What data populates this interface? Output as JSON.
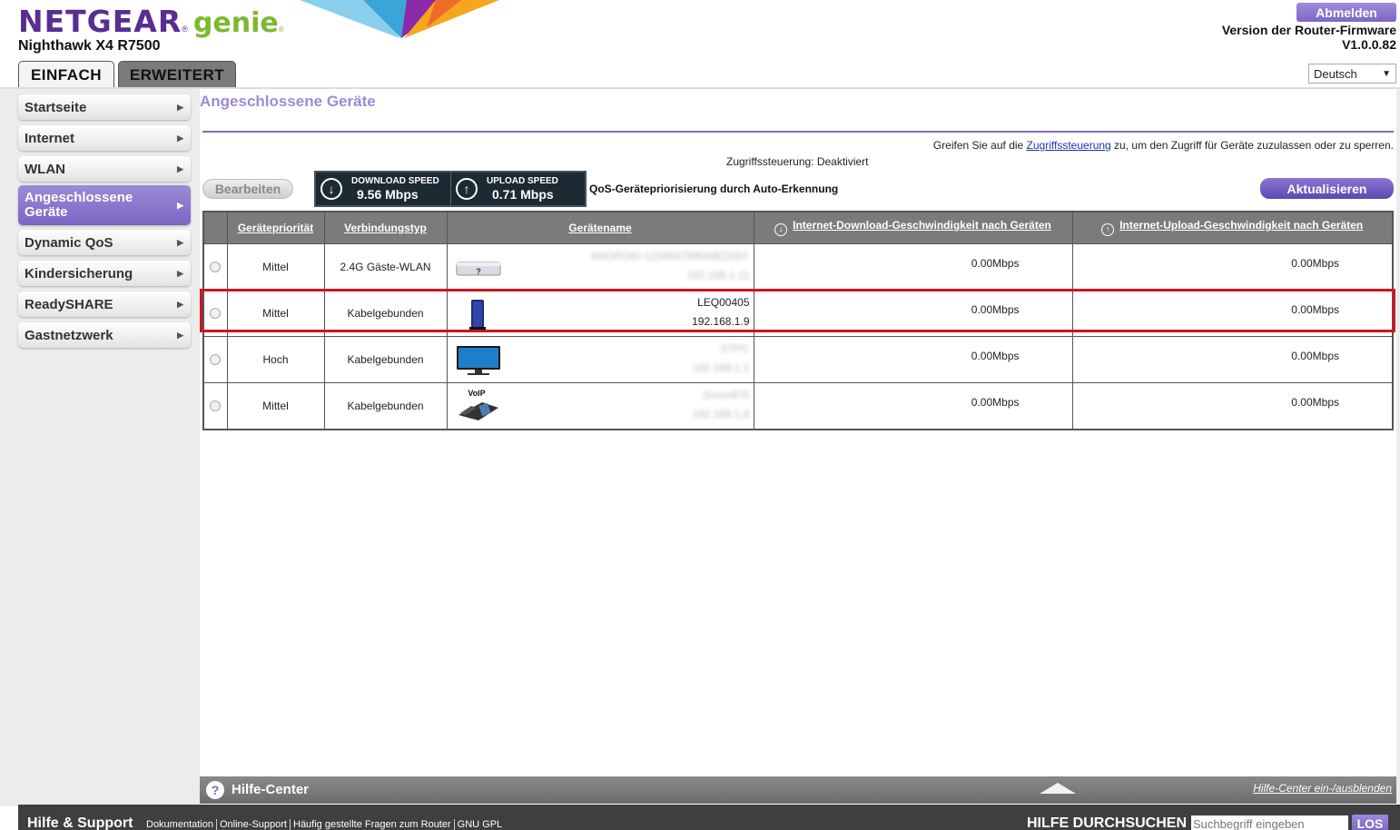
{
  "header": {
    "brand": "NETGEAR",
    "reg_mark": "®",
    "genie": "genie",
    "model": "Nighthawk X4 R7500",
    "logout_label": "Abmelden",
    "firmware_label": "Version der Router-Firmware",
    "firmware_version": "V1.0.0.82",
    "language": "Deutsch",
    "tabs": [
      {
        "label": "EINFACH",
        "active": true
      },
      {
        "label": "ERWEITERT",
        "active": false
      }
    ]
  },
  "sidebar": {
    "items": [
      {
        "label": "Startseite"
      },
      {
        "label": "Internet"
      },
      {
        "label": "WLAN"
      },
      {
        "label": "Angeschlossene Geräte",
        "active": true
      },
      {
        "label": "Dynamic QoS"
      },
      {
        "label": "Kindersicherung"
      },
      {
        "label": "ReadySHARE"
      },
      {
        "label": "Gastnetzwerk"
      }
    ]
  },
  "main": {
    "title": "Angeschlossene Geräte",
    "access_prefix": "Greifen Sie auf die ",
    "access_link": "Zugriffssteuerung",
    "access_suffix": " zu, um den Zugriff für Geräte zuzulassen oder zu sperren.",
    "access_status": "Zugriffssteuerung: Deaktiviert",
    "edit_label": "Bearbeiten",
    "download_label": "DOWNLOAD SPEED",
    "download_value": "9.56 Mbps",
    "upload_label": "UPLOAD SPEED",
    "upload_value": "0.71 Mbps",
    "qos_text": "QoS-Gerätepriorisierung durch Auto-Erkennung",
    "refresh_label": "Aktualisieren",
    "table": {
      "headers": [
        "Gerätepriorität",
        "Verbindungstyp",
        "Gerätename",
        "Internet-Download-Geschwindigkeit nach Geräten",
        "Internet-Upload-Geschwindigkeit nach Geräten"
      ],
      "rows": [
        {
          "priority": "Mittel",
          "type": "2.4G Gäste-WLAN",
          "icon": "unknown-device-icon",
          "name": "ANDROID-1234567890ABCDEF",
          "ip": "192.168.1.11",
          "blurred": true,
          "down": "0.00Mbps",
          "up": "0.00Mbps"
        },
        {
          "priority": "Mittel",
          "type": "Kabelgebunden",
          "icon": "router-device-icon",
          "name": "LEQ00405",
          "ip": "192.168.1.9",
          "blurred": false,
          "down": "0.00Mbps",
          "up": "0.00Mbps"
        },
        {
          "priority": "Hoch",
          "type": "Kabelgebunden",
          "icon": "monitor-device-icon",
          "name": "STPC",
          "ip": "192.168.1.2",
          "blurred": true,
          "down": "0.00Mbps",
          "up": "0.00Mbps"
        },
        {
          "priority": "Mittel",
          "type": "Kabelgebunden",
          "icon": "voip-phone-icon",
          "name": "Snom870",
          "ip": "192.168.1.8",
          "blurred": true,
          "down": "0.00Mbps",
          "up": "0.00Mbps"
        }
      ]
    }
  },
  "help_center": {
    "title": "Hilfe-Center",
    "toggle": "Hilfe-Center ein-/ausblenden"
  },
  "footer": {
    "help_support": "Hilfe & Support",
    "links": [
      "Dokumentation",
      "Online-Support",
      "Häufig gestellte Fragen zum Router",
      "GNU GPL"
    ],
    "search_title": "HILFE DURCHSUCHEN",
    "search_placeholder": "Suchbegriff eingeben",
    "search_go": "LOS"
  },
  "colors": {
    "brand_purple": "#5a2d91",
    "genie_green": "#7cb82f",
    "accent": "#7a66c3",
    "highlight_red": "#d0141d"
  }
}
